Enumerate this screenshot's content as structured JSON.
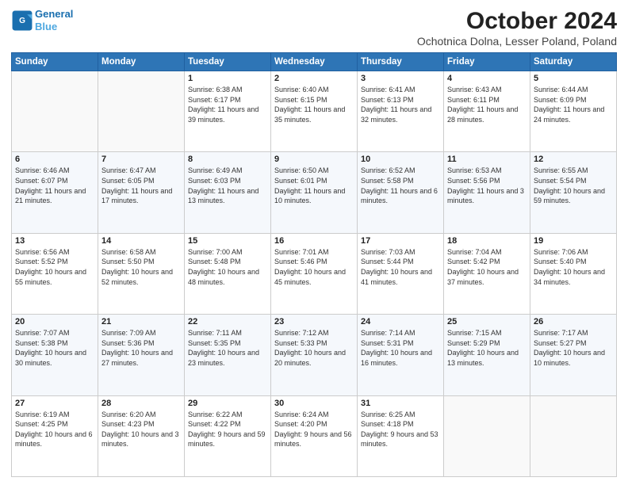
{
  "logo": {
    "line1": "General",
    "line2": "Blue"
  },
  "title": "October 2024",
  "subtitle": "Ochotnica Dolna, Lesser Poland, Poland",
  "weekdays": [
    "Sunday",
    "Monday",
    "Tuesday",
    "Wednesday",
    "Thursday",
    "Friday",
    "Saturday"
  ],
  "weeks": [
    [
      {
        "day": "",
        "sunrise": "",
        "sunset": "",
        "daylight": ""
      },
      {
        "day": "",
        "sunrise": "",
        "sunset": "",
        "daylight": ""
      },
      {
        "day": "1",
        "sunrise": "Sunrise: 6:38 AM",
        "sunset": "Sunset: 6:17 PM",
        "daylight": "Daylight: 11 hours and 39 minutes."
      },
      {
        "day": "2",
        "sunrise": "Sunrise: 6:40 AM",
        "sunset": "Sunset: 6:15 PM",
        "daylight": "Daylight: 11 hours and 35 minutes."
      },
      {
        "day": "3",
        "sunrise": "Sunrise: 6:41 AM",
        "sunset": "Sunset: 6:13 PM",
        "daylight": "Daylight: 11 hours and 32 minutes."
      },
      {
        "day": "4",
        "sunrise": "Sunrise: 6:43 AM",
        "sunset": "Sunset: 6:11 PM",
        "daylight": "Daylight: 11 hours and 28 minutes."
      },
      {
        "day": "5",
        "sunrise": "Sunrise: 6:44 AM",
        "sunset": "Sunset: 6:09 PM",
        "daylight": "Daylight: 11 hours and 24 minutes."
      }
    ],
    [
      {
        "day": "6",
        "sunrise": "Sunrise: 6:46 AM",
        "sunset": "Sunset: 6:07 PM",
        "daylight": "Daylight: 11 hours and 21 minutes."
      },
      {
        "day": "7",
        "sunrise": "Sunrise: 6:47 AM",
        "sunset": "Sunset: 6:05 PM",
        "daylight": "Daylight: 11 hours and 17 minutes."
      },
      {
        "day": "8",
        "sunrise": "Sunrise: 6:49 AM",
        "sunset": "Sunset: 6:03 PM",
        "daylight": "Daylight: 11 hours and 13 minutes."
      },
      {
        "day": "9",
        "sunrise": "Sunrise: 6:50 AM",
        "sunset": "Sunset: 6:01 PM",
        "daylight": "Daylight: 11 hours and 10 minutes."
      },
      {
        "day": "10",
        "sunrise": "Sunrise: 6:52 AM",
        "sunset": "Sunset: 5:58 PM",
        "daylight": "Daylight: 11 hours and 6 minutes."
      },
      {
        "day": "11",
        "sunrise": "Sunrise: 6:53 AM",
        "sunset": "Sunset: 5:56 PM",
        "daylight": "Daylight: 11 hours and 3 minutes."
      },
      {
        "day": "12",
        "sunrise": "Sunrise: 6:55 AM",
        "sunset": "Sunset: 5:54 PM",
        "daylight": "Daylight: 10 hours and 59 minutes."
      }
    ],
    [
      {
        "day": "13",
        "sunrise": "Sunrise: 6:56 AM",
        "sunset": "Sunset: 5:52 PM",
        "daylight": "Daylight: 10 hours and 55 minutes."
      },
      {
        "day": "14",
        "sunrise": "Sunrise: 6:58 AM",
        "sunset": "Sunset: 5:50 PM",
        "daylight": "Daylight: 10 hours and 52 minutes."
      },
      {
        "day": "15",
        "sunrise": "Sunrise: 7:00 AM",
        "sunset": "Sunset: 5:48 PM",
        "daylight": "Daylight: 10 hours and 48 minutes."
      },
      {
        "day": "16",
        "sunrise": "Sunrise: 7:01 AM",
        "sunset": "Sunset: 5:46 PM",
        "daylight": "Daylight: 10 hours and 45 minutes."
      },
      {
        "day": "17",
        "sunrise": "Sunrise: 7:03 AM",
        "sunset": "Sunset: 5:44 PM",
        "daylight": "Daylight: 10 hours and 41 minutes."
      },
      {
        "day": "18",
        "sunrise": "Sunrise: 7:04 AM",
        "sunset": "Sunset: 5:42 PM",
        "daylight": "Daylight: 10 hours and 37 minutes."
      },
      {
        "day": "19",
        "sunrise": "Sunrise: 7:06 AM",
        "sunset": "Sunset: 5:40 PM",
        "daylight": "Daylight: 10 hours and 34 minutes."
      }
    ],
    [
      {
        "day": "20",
        "sunrise": "Sunrise: 7:07 AM",
        "sunset": "Sunset: 5:38 PM",
        "daylight": "Daylight: 10 hours and 30 minutes."
      },
      {
        "day": "21",
        "sunrise": "Sunrise: 7:09 AM",
        "sunset": "Sunset: 5:36 PM",
        "daylight": "Daylight: 10 hours and 27 minutes."
      },
      {
        "day": "22",
        "sunrise": "Sunrise: 7:11 AM",
        "sunset": "Sunset: 5:35 PM",
        "daylight": "Daylight: 10 hours and 23 minutes."
      },
      {
        "day": "23",
        "sunrise": "Sunrise: 7:12 AM",
        "sunset": "Sunset: 5:33 PM",
        "daylight": "Daylight: 10 hours and 20 minutes."
      },
      {
        "day": "24",
        "sunrise": "Sunrise: 7:14 AM",
        "sunset": "Sunset: 5:31 PM",
        "daylight": "Daylight: 10 hours and 16 minutes."
      },
      {
        "day": "25",
        "sunrise": "Sunrise: 7:15 AM",
        "sunset": "Sunset: 5:29 PM",
        "daylight": "Daylight: 10 hours and 13 minutes."
      },
      {
        "day": "26",
        "sunrise": "Sunrise: 7:17 AM",
        "sunset": "Sunset: 5:27 PM",
        "daylight": "Daylight: 10 hours and 10 minutes."
      }
    ],
    [
      {
        "day": "27",
        "sunrise": "Sunrise: 6:19 AM",
        "sunset": "Sunset: 4:25 PM",
        "daylight": "Daylight: 10 hours and 6 minutes."
      },
      {
        "day": "28",
        "sunrise": "Sunrise: 6:20 AM",
        "sunset": "Sunset: 4:23 PM",
        "daylight": "Daylight: 10 hours and 3 minutes."
      },
      {
        "day": "29",
        "sunrise": "Sunrise: 6:22 AM",
        "sunset": "Sunset: 4:22 PM",
        "daylight": "Daylight: 9 hours and 59 minutes."
      },
      {
        "day": "30",
        "sunrise": "Sunrise: 6:24 AM",
        "sunset": "Sunset: 4:20 PM",
        "daylight": "Daylight: 9 hours and 56 minutes."
      },
      {
        "day": "31",
        "sunrise": "Sunrise: 6:25 AM",
        "sunset": "Sunset: 4:18 PM",
        "daylight": "Daylight: 9 hours and 53 minutes."
      },
      {
        "day": "",
        "sunrise": "",
        "sunset": "",
        "daylight": ""
      },
      {
        "day": "",
        "sunrise": "",
        "sunset": "",
        "daylight": ""
      }
    ]
  ]
}
